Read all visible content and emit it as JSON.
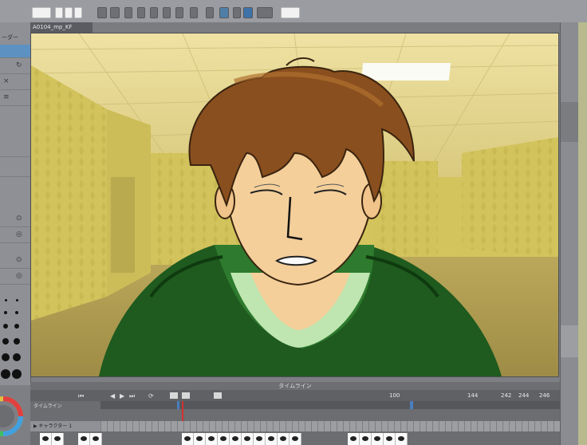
{
  "document": {
    "tab_title": "A0104_mp_KF"
  },
  "left_panel": {
    "header_label": "ーダー",
    "glyphs": [
      "↻",
      "×",
      "≡",
      "⊙",
      "◎",
      "⊙",
      "◎"
    ]
  },
  "timeline": {
    "header": "タイムライン",
    "track_name": "タイムライン",
    "track_label": "▶ キャラクター 1",
    "frame_numbers": [
      "100",
      "144",
      "242",
      "244",
      "246"
    ],
    "controls": [
      "⏮",
      "◀",
      "▶",
      "⏭",
      "⟳"
    ]
  },
  "colors": {
    "app_bg": "#7d7f84",
    "panel": "#8e9095",
    "accent_blue": "#5d91c2",
    "playhead_red": "#d43030",
    "canvas_wall": "#d4c45e",
    "hoodie": "#1f5a1f",
    "hair": "#8a4f1e",
    "skin": "#f4cf9a"
  },
  "icons": [
    "undo-icon",
    "redo-icon",
    "new-file-icon",
    "save-icon",
    "grid-icon",
    "snap-icon",
    "color-wheel-icon",
    "play-icon",
    "stop-icon",
    "keyframe-icon"
  ]
}
